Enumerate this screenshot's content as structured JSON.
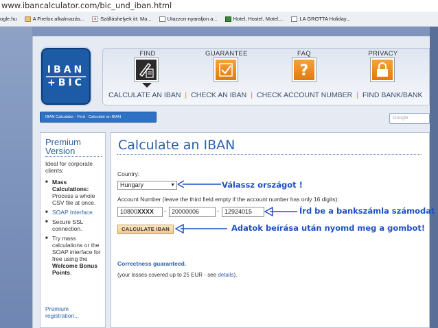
{
  "browser": {
    "url": "www.ibancalculator.com/bic_und_iban.html",
    "bookmarks": [
      {
        "label": "ogle.hu",
        "icon": "page-icon"
      },
      {
        "label": "A Firefox alkalmazás...",
        "icon": "folder-icon"
      },
      {
        "label": "Szálláshelyek itt: Ma...",
        "icon": "bookmark-icon"
      },
      {
        "label": "Utazzon-nyaraljon a...",
        "icon": "page-icon"
      },
      {
        "label": "Hotel, Hostel, Motel,...",
        "icon": "green-icon"
      },
      {
        "label": "LA GROTTA Holiday...",
        "icon": "page-icon"
      }
    ]
  },
  "logo": {
    "line1": "IBAN",
    "line2": "+BIC"
  },
  "nav": {
    "top_items": [
      {
        "label": "FIND",
        "icon": "pen-icon"
      },
      {
        "label": "GUARANTEE",
        "icon": "checkbox-icon"
      },
      {
        "label": "FAQ",
        "icon": "question-icon"
      },
      {
        "label": "PRIVACY",
        "icon": "lock-icon"
      }
    ],
    "tabs": [
      "CALCULATE AN IBAN",
      "CHECK AN IBAN",
      "CHECK ACCOUNT NUMBER",
      "FIND BANK/BANK"
    ]
  },
  "breadcrumb": "IBAN Calculator · Find · Calculate an IBAN",
  "search": {
    "placeholder": "Google"
  },
  "premium": {
    "title": "Premium Version",
    "intro": "Ideal for corporate clients:",
    "items": [
      {
        "bold": "Mass Calculations:",
        "rest": "Process a whole CSV file at once."
      },
      {
        "text": "SOAP Interface."
      },
      {
        "text": "Secure SSL connection."
      },
      {
        "text": "Try mass calculations or the SOAP interface for free using the",
        "bold2": "Welcome Bonus Points",
        "end": "."
      }
    ],
    "registration": "Premium registration..."
  },
  "main": {
    "heading": "Calculate an IBAN",
    "country_label": "Country:",
    "country_value": "Hungary",
    "account_label": "Account Number (leave the third field empty if the account number has only 16 digits):",
    "account": {
      "part1_prefix": "10800",
      "part1_mask": "XXXX",
      "part2": "20000006",
      "part3": "12924015"
    },
    "calc_button": "CALCULATE IBAN",
    "guarantee": "Correctness guaranteed.",
    "losses_text": "(your losses covered up to 25 EUR - see",
    "losses_link": "details",
    "losses_end": ")."
  },
  "annotations": {
    "country": "Válassz országot !",
    "account": "Írd be a bankszámla számodat !",
    "button": "Adatok beírása után nyomd meg a gombot!"
  },
  "colors": {
    "annotation": "#1f4fc2",
    "accent_orange": "#e07a10",
    "heading_blue": "#2b5fa8"
  }
}
